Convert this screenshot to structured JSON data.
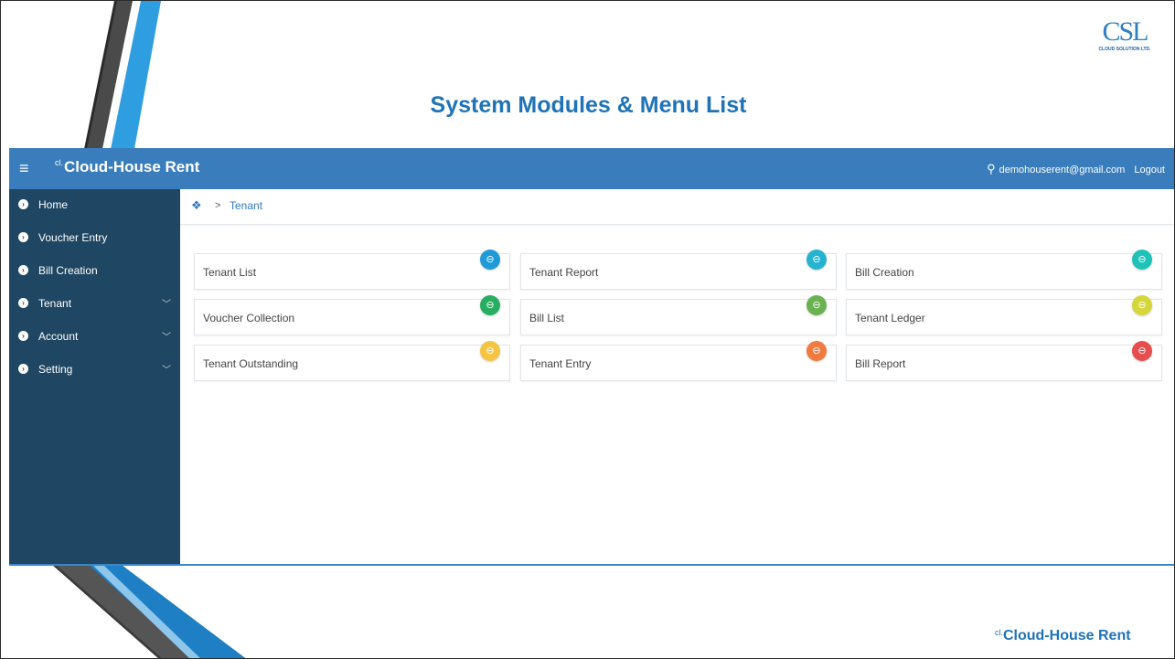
{
  "slide": {
    "title": "System Modules & Menu List",
    "logo_mark": "CSL",
    "logo_text": "CLOUD SOLUTION LTD.",
    "footer_brand_prefix": "cl.",
    "footer_brand": "Cloud-House Rent"
  },
  "header": {
    "menu_icon": "≡",
    "brand_prefix": "cl.",
    "brand": "Cloud-House Rent",
    "user_icon": "user-icon",
    "user_email": "demohouserent@gmail.com",
    "logout_label": "Logout"
  },
  "sidebar": {
    "items": [
      {
        "label": "Home",
        "has_children": false
      },
      {
        "label": "Voucher Entry",
        "has_children": false
      },
      {
        "label": "Bill Creation",
        "has_children": false
      },
      {
        "label": "Tenant",
        "has_children": true
      },
      {
        "label": "Account",
        "has_children": true
      },
      {
        "label": "Setting",
        "has_children": true
      }
    ]
  },
  "breadcrumb": {
    "home_icon": "home-icon",
    "separator": ">",
    "current": "Tenant"
  },
  "modules": [
    {
      "label": "Tenant List",
      "color": "#1e9bd7"
    },
    {
      "label": "Tenant Report",
      "color": "#26b3cf"
    },
    {
      "label": "Bill Creation",
      "color": "#1fc2b8"
    },
    {
      "label": "Voucher Collection",
      "color": "#27ae60"
    },
    {
      "label": "Bill List",
      "color": "#6ab150"
    },
    {
      "label": "Tenant Ledger",
      "color": "#d4d63a"
    },
    {
      "label": "Tenant Outstanding",
      "color": "#f5c542"
    },
    {
      "label": "Tenant Entry",
      "color": "#f07b3f"
    },
    {
      "label": "Bill Report",
      "color": "#e84d4d"
    }
  ],
  "colors": {
    "topbar": "#3a7dbc",
    "sidebar": "#1f4662",
    "accent": "#1f73b7"
  }
}
